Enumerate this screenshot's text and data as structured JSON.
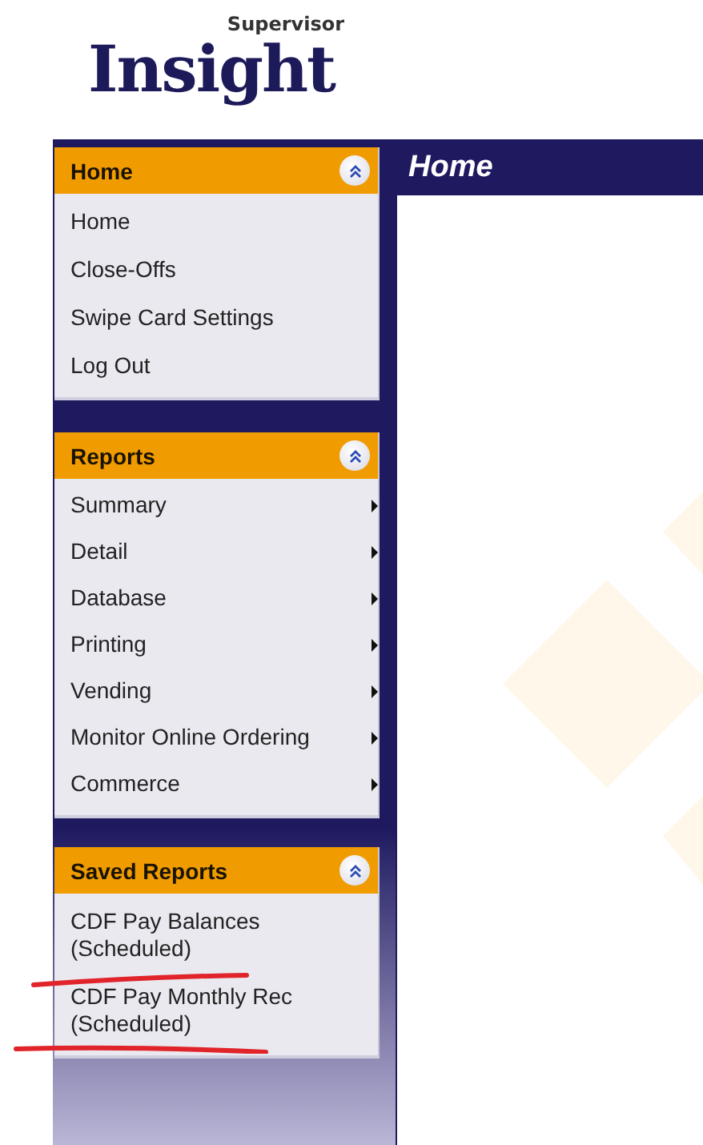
{
  "logo": {
    "small": "Supervisor",
    "large": "Insight"
  },
  "page_title": "Home",
  "sections": [
    {
      "title": "Home",
      "expanded": true,
      "items": [
        {
          "label": "Home",
          "kind": "link"
        },
        {
          "label": "Close-Offs",
          "kind": "link"
        },
        {
          "label": "Swipe Card Settings",
          "kind": "link"
        },
        {
          "label": "Log Out",
          "kind": "link"
        }
      ]
    },
    {
      "title": "Reports",
      "expanded": true,
      "items": [
        {
          "label": "Summary",
          "kind": "submenu"
        },
        {
          "label": "Detail",
          "kind": "submenu"
        },
        {
          "label": "Database",
          "kind": "submenu"
        },
        {
          "label": "Printing",
          "kind": "submenu"
        },
        {
          "label": "Vending",
          "kind": "submenu"
        },
        {
          "label": "Monitor Online Ordering",
          "kind": "submenu"
        },
        {
          "label": "Commerce",
          "kind": "submenu"
        }
      ]
    },
    {
      "title": "Saved Reports",
      "expanded": true,
      "items": [
        {
          "label": "CDF Pay Balances (Scheduled)",
          "kind": "report"
        },
        {
          "label": "CDF Pay Monthly Rec (Scheduled)",
          "kind": "report"
        }
      ]
    }
  ]
}
